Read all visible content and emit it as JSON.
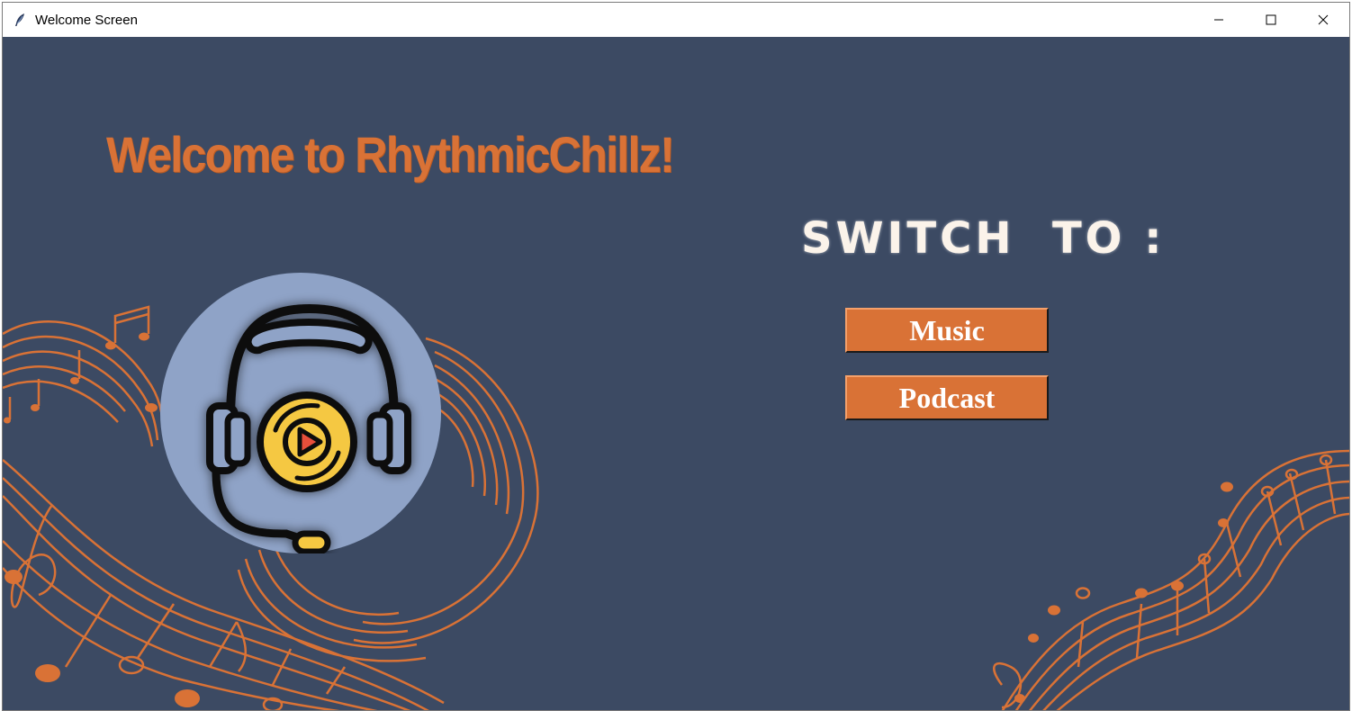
{
  "window": {
    "title": "Welcome Screen"
  },
  "main": {
    "welcome_heading": "Welcome to RhythmicChillz!",
    "switch_label": "SWITCH  TO :",
    "buttons": {
      "music": "Music",
      "podcast": "Podcast"
    }
  },
  "icons": {
    "app": "feather-icon",
    "minimize": "minimize-icon",
    "maximize": "maximize-icon",
    "close": "close-icon",
    "logo": "headphones-play-icon"
  },
  "colors": {
    "background": "#3c4a63",
    "accent": "#d97236",
    "logo_circle": "#8fa3c7",
    "disc_yellow": "#f5c842",
    "play_red": "#e8503a"
  }
}
